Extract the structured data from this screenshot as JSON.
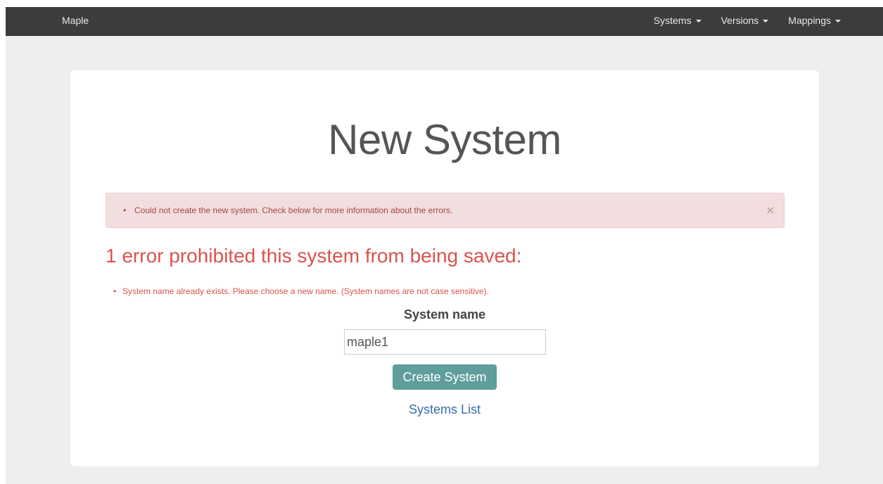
{
  "navbar": {
    "brand": "Maple",
    "menus": [
      {
        "label": "Systems"
      },
      {
        "label": "Versions"
      },
      {
        "label": "Mappings"
      }
    ]
  },
  "main": {
    "title": "New System",
    "alert": {
      "message": "Could not create the new system. Check below for more information about the errors.",
      "close_label": "×"
    },
    "errors": {
      "heading": "1 error prohibited this system from being saved:",
      "items": [
        "System name already exists. Please choose a new name. (System names are not case sensitive)."
      ]
    },
    "form": {
      "label": "System name",
      "value": "maple1",
      "submit_label": "Create System"
    },
    "link_label": "Systems List"
  },
  "colors": {
    "navbar": "#3c3c3c",
    "alert_bg": "#f2dede",
    "error_text": "#d9534f",
    "button": "#5e9e9b",
    "link": "#3a6ea5"
  },
  "icons": {
    "dropdown": "caret-down-icon",
    "close": "close-icon"
  }
}
